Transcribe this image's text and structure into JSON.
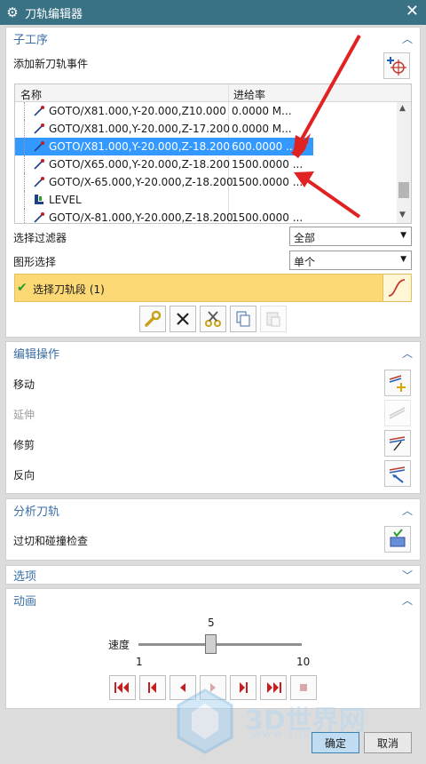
{
  "window": {
    "title": "刀轨编辑器",
    "close": "✕"
  },
  "sections": {
    "sub_op": {
      "title": "子工序",
      "add_event_label": "添加新刀轨事件"
    },
    "edit_ops": {
      "title": "编辑操作",
      "move": "移动",
      "extend": "延伸",
      "trim": "修剪",
      "reverse": "反向"
    },
    "analysis": {
      "title": "分析刀轨",
      "check": "过切和碰撞检查"
    },
    "options": {
      "title": "选项"
    },
    "animation": {
      "title": "动画",
      "speed_label": "速度",
      "speed_value": "5",
      "speed_min": "1",
      "speed_max": "10",
      "speed_fraction": 0.444
    }
  },
  "table": {
    "columns": [
      "名称",
      "进给率"
    ],
    "rows": [
      {
        "name": "GOTO/X81.000,Y-20.000,Z10.000",
        "feed": "0.0000 M...",
        "icon": "goto-icon",
        "selected": false
      },
      {
        "name": "GOTO/X81.000,Y-20.000,Z-17.200",
        "feed": "0.0000 M...",
        "icon": "goto-icon",
        "selected": false
      },
      {
        "name": "GOTO/X81.000,Y-20.000,Z-18.200",
        "feed": "600.0000 ...",
        "icon": "goto-icon",
        "selected": true
      },
      {
        "name": "GOTO/X65.000,Y-20.000,Z-18.200",
        "feed": "1500.0000 ...",
        "icon": "goto-icon",
        "selected": false
      },
      {
        "name": "GOTO/X-65.000,Y-20.000,Z-18.200",
        "feed": "1500.0000 ...",
        "icon": "goto-icon",
        "selected": false
      },
      {
        "name": "LEVEL",
        "feed": "",
        "icon": "level-icon",
        "selected": false
      },
      {
        "name": "GOTO/X-81.000,Y-20.000,Z-18.200",
        "feed": "1500.0000 ...",
        "icon": "goto-icon",
        "selected": false
      }
    ]
  },
  "filters": {
    "select_filter_label": "选择过滤器",
    "select_filter_value": "全部",
    "graphic_select_label": "图形选择",
    "graphic_select_value": "单个"
  },
  "selection": {
    "label": "选择刀轨段 (1)"
  },
  "buttons": {
    "ok": "确定",
    "cancel": "取消"
  },
  "watermark": {
    "text": "3D世界网",
    "url": "WWW.3DSJW.COM"
  },
  "colors": {
    "titlebar": "#3a7285",
    "selected_row": "#3399ff",
    "selection_bar": "#fcd975",
    "section_title": "#3b6ea5"
  }
}
